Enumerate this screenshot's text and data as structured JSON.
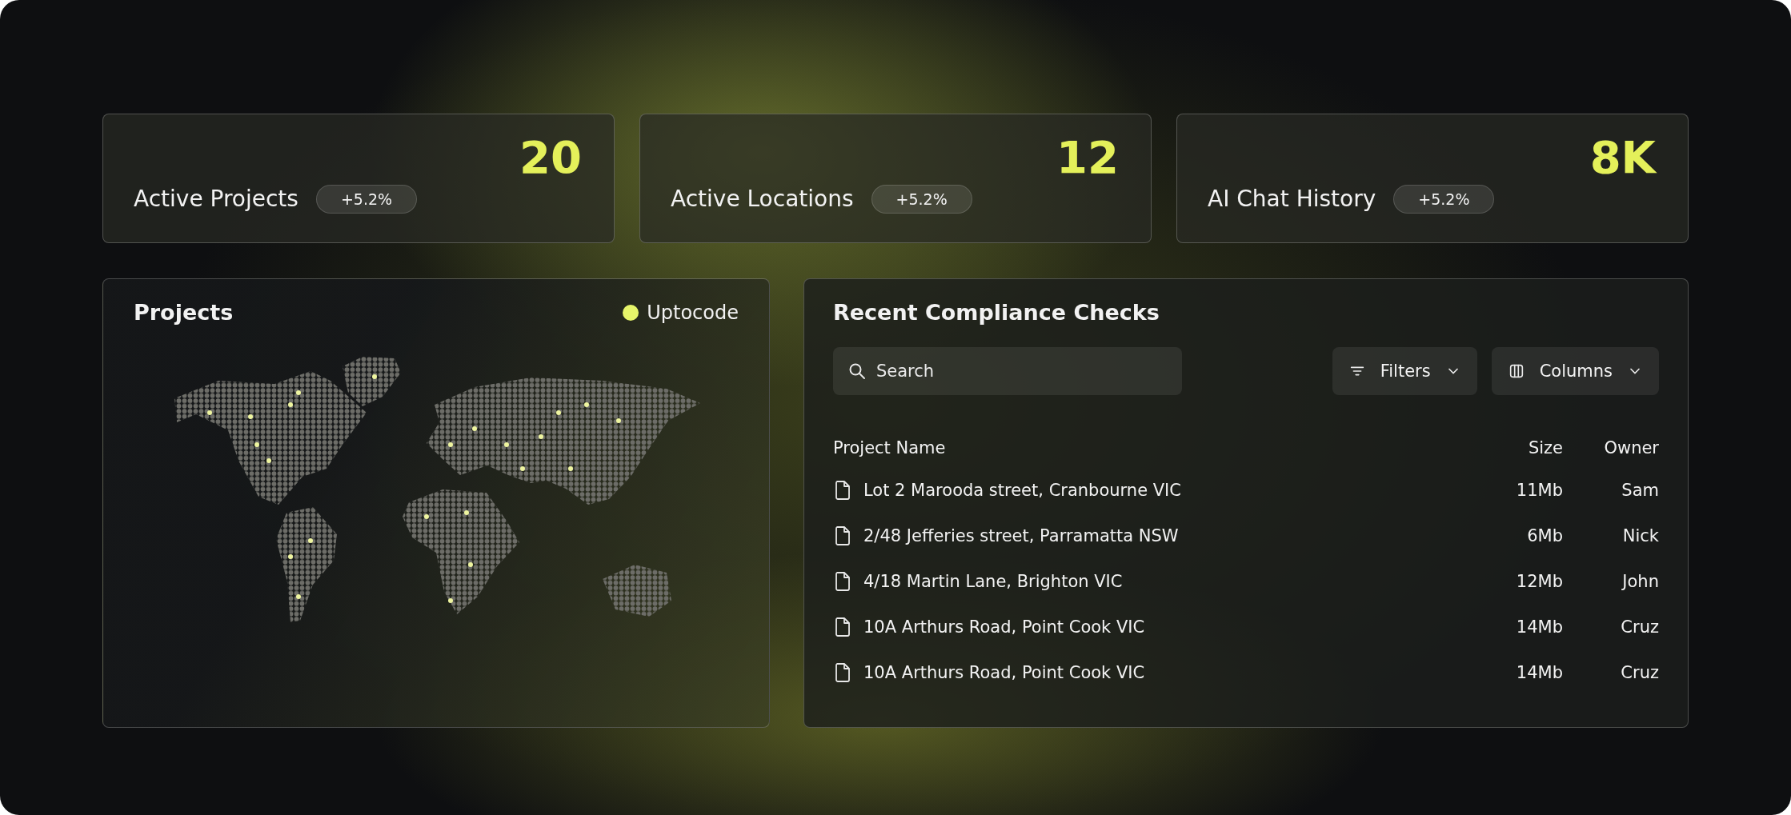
{
  "stats": [
    {
      "value": "20",
      "label": "Active Projects",
      "change": "+5.2%"
    },
    {
      "value": "12",
      "label": "Active Locations",
      "change": "+5.2%"
    },
    {
      "value": "8K",
      "label": "AI Chat History",
      "change": "+5.2%"
    }
  ],
  "map_panel": {
    "title": "Projects",
    "legend": "Uptocode"
  },
  "checks_panel": {
    "title": "Recent Compliance Checks",
    "search": {
      "placeholder": "Search"
    },
    "buttons": [
      {
        "kind": "filters",
        "label": "Filters"
      },
      {
        "kind": "columns",
        "label": "Columns"
      }
    ],
    "columns": [
      "Project Name",
      "Size",
      "Owner"
    ],
    "rows": [
      {
        "name": "Lot 2 Marooda street, Cranbourne VIC",
        "size": "11Mb",
        "owner": "Sam"
      },
      {
        "name": "2/48 Jefferies street, Parramatta NSW",
        "size": "6Mb",
        "owner": "Nick"
      },
      {
        "name": "4/18 Martin Lane, Brighton VIC",
        "size": "12Mb",
        "owner": "John"
      },
      {
        "name": "10A Arthurs Road, Point Cook VIC",
        "size": "14Mb",
        "owner": "Cruz"
      },
      {
        "name": "10A Arthurs Road, Point Cook VIC",
        "size": "14Mb",
        "owner": "Cruz"
      }
    ]
  }
}
